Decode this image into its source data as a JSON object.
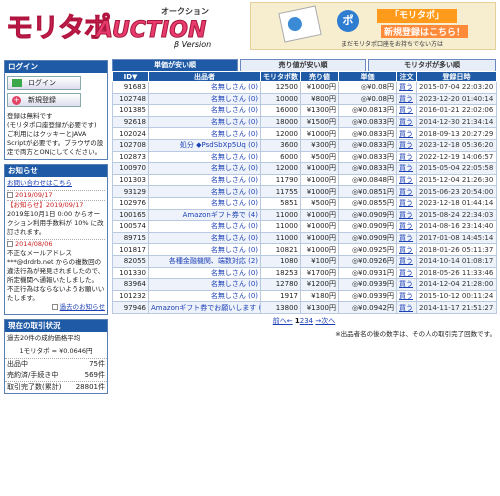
{
  "header": {
    "logo_main": "モリタポ",
    "logo_auction": "AUCTION",
    "logo_oku": "オークション",
    "logo_beta": "β Version",
    "banner_title": "「モリタポ」",
    "banner_sub": "新規登録はこちら！",
    "banner_note": "まだモリタポ口座をお持ちでない方は",
    "banner_circle": "ポ"
  },
  "sidebar": {
    "login_title": "ログイン",
    "login_button": "ログイン",
    "register_button": "新規登録",
    "login_text": "登録は無料です\n(モリタポ口座登録が必要です)\nご利用にはクッキーとJAVA Scriptが必要です。ブラウザの設定で両方とONにしてください。",
    "notice_title": "お知らせ",
    "notice_link": "お問い合わせはこちら",
    "notices": [
      {
        "date": "2019/09/17",
        "body": ""
      },
      {
        "date": "【お知らせ】2019/09/17",
        "body": "2019年10月1日 0:00 からオークション利用手数料が 10% に改訂されます。"
      },
      {
        "date": "2014/08/06",
        "body": "不正なメールアドレス ***@drdrb.net からの複数回の違法行為が発見されましたので、所定機関へ通報いたしました。\n不正行為はならないようお願いいたします。"
      }
    ],
    "past_notices": "過去のお知らせ",
    "trade_title": "現在の取引状況",
    "trade_avg_label": "過去20件の成約価格平均",
    "trade_avg_value": "1モリタポ = ¥0.0646円",
    "stats": [
      {
        "label": "出品中",
        "value": "75件"
      },
      {
        "label": "売約済/手続き中",
        "value": "569件"
      },
      {
        "label": "取引完了数(累計)",
        "value": "28801件"
      }
    ]
  },
  "tabs": [
    {
      "label": "単価が安い順",
      "active": true
    },
    {
      "label": "売り値が安い順",
      "active": false
    },
    {
      "label": "モリタポが多い順",
      "active": false
    }
  ],
  "columns": [
    "ID▼",
    "出品者",
    "モリタポ数",
    "売り値",
    "単価",
    "注文",
    "登録日時"
  ],
  "rows": [
    [
      "91683",
      "名無しさん (0)",
      "12500",
      "¥1000円",
      "◎¥0.08円",
      "買う",
      "2015-07-04 22:03:20"
    ],
    [
      "102748",
      "名無しさん (0)",
      "10000",
      "¥800円",
      "◎¥0.08円",
      "買う",
      "2023-12-20 01:40:14"
    ],
    [
      "101385",
      "名無しさん (0)",
      "16000",
      "¥1300円",
      "◎¥0.0813円",
      "買う",
      "2016-01-21 22:02:06"
    ],
    [
      "92618",
      "名無しさん (0)",
      "18000",
      "¥1500円",
      "◎¥0.0833円",
      "買う",
      "2014-12-30 21:34:14"
    ],
    [
      "102024",
      "名無しさん (0)",
      "12000",
      "¥1000円",
      "◎¥0.0833円",
      "買う",
      "2018-09-13 20:27:29"
    ],
    [
      "102708",
      "処分 ◆PsdSbXp5Uq (0)",
      "3600",
      "¥300円",
      "◎¥0.0833円",
      "買う",
      "2023-12-18 05:36:20"
    ],
    [
      "102873",
      "名無しさん (0)",
      "6000",
      "¥500円",
      "◎¥0.0833円",
      "買う",
      "2022-12-19 14:06:57"
    ],
    [
      "100970",
      "名無しさん (0)",
      "12000",
      "¥1000円",
      "◎¥0.0833円",
      "買う",
      "2015-05-04 22:05:58"
    ],
    [
      "101303",
      "名無しさん (0)",
      "11790",
      "¥1000円",
      "◎¥0.0848円",
      "買う",
      "2015-12-04 21:26:30"
    ],
    [
      "93129",
      "名無しさん (0)",
      "11755",
      "¥1000円",
      "◎¥0.0851円",
      "買う",
      "2015-06-23 20:54:00"
    ],
    [
      "102976",
      "名無しさん (0)",
      "5851",
      "¥500円",
      "◎¥0.0855円",
      "買う",
      "2023-12-18 01:44:14"
    ],
    [
      "100165",
      "Amazonギフト券で (4)",
      "11000",
      "¥1000円",
      "◎¥0.0909円",
      "買う",
      "2015-08-24 22:34:03"
    ],
    [
      "100574",
      "名無しさん (0)",
      "11000",
      "¥1000円",
      "◎¥0.0909円",
      "買う",
      "2014-08-16 23:14:40"
    ],
    [
      "89715",
      "名無しさん (0)",
      "11000",
      "¥1000円",
      "◎¥0.0909円",
      "買う",
      "2017-01-08 14:45:14"
    ],
    [
      "101817",
      "名無しさん (0)",
      "10821",
      "¥1000円",
      "◎¥0.0925円",
      "買う",
      "2018-01-26 05:11:37"
    ],
    [
      "82055",
      "各種金融機関、端数対応 (2)",
      "1080",
      "¥100円",
      "◎¥0.0926円",
      "買う",
      "2014-10-14 01:08:17"
    ],
    [
      "101330",
      "名無しさん (0)",
      "18253",
      "¥1700円",
      "◎¥0.0931円",
      "買う",
      "2018-05-26 11:33:46"
    ],
    [
      "83964",
      "名無しさん (0)",
      "12780",
      "¥1200円",
      "◎¥0.0939円",
      "買う",
      "2014-12-04 21:28:00"
    ],
    [
      "101232",
      "名無しさん (0)",
      "1917",
      "¥180円",
      "◎¥0.0939円",
      "買う",
      "2015-10-12 00:11:24"
    ],
    [
      "97946",
      "Amazonギフト券でお願いします (0)",
      "13800",
      "¥1300円",
      "◎¥0.0942円",
      "買う",
      "2014-11-17 21:51:27"
    ]
  ],
  "pager": {
    "prev": "前へ←",
    "current": "1",
    "pages": [
      "2",
      "3",
      "4"
    ],
    "next": "→次へ"
  },
  "note": "※出品者名の後の数字は、その人の取引完了回数です。"
}
